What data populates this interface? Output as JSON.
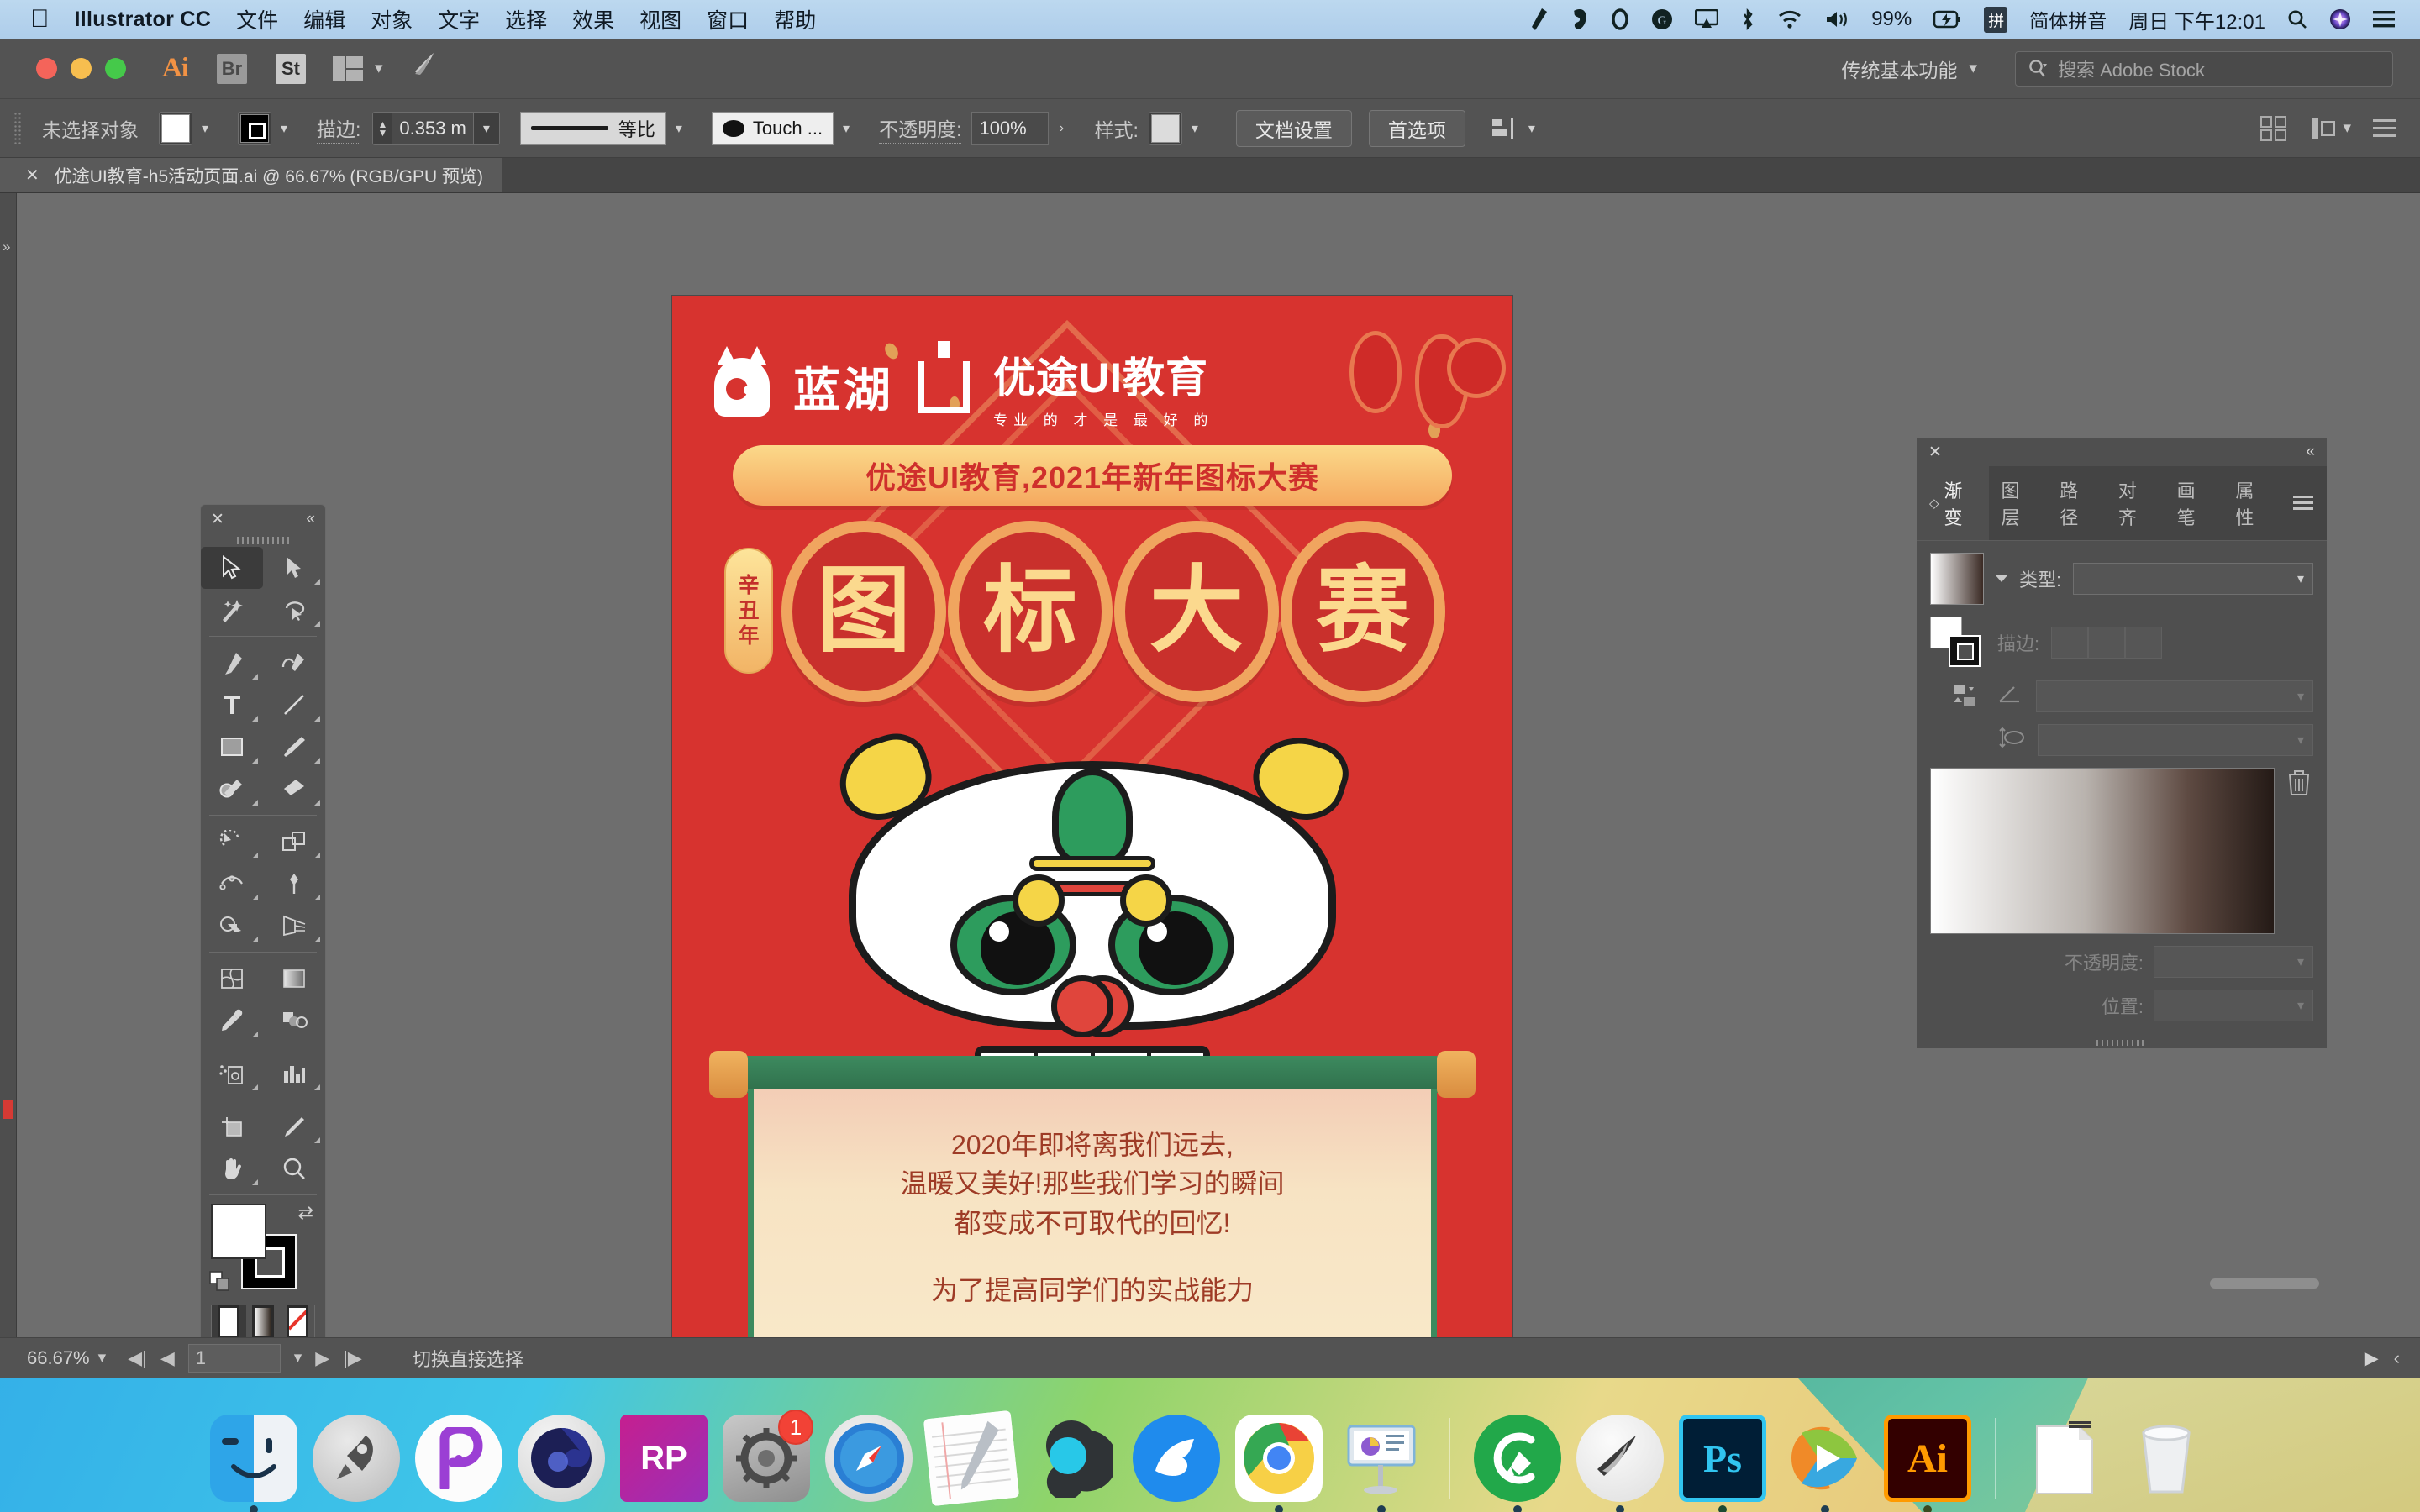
{
  "menubar": {
    "apple": "",
    "app_name": "Illustrator CC",
    "items": [
      "文件",
      "编辑",
      "对象",
      "文字",
      "选择",
      "效果",
      "视图",
      "窗口",
      "帮助"
    ],
    "status": {
      "battery_percent": "99%",
      "ime_chip": "拼",
      "ime_name": "简体拼音",
      "clock": "周日 下午12:01"
    },
    "icons": [
      "pen-tool-icon",
      "evernote-icon",
      "circle-icon",
      "grammarly-icon",
      "airplay-icon",
      "bluetooth-icon",
      "wifi-icon",
      "volume-icon",
      "battery-icon",
      "search-icon",
      "siri-icon",
      "control-center-icon"
    ]
  },
  "appbar": {
    "ai_logo": "Ai",
    "bridge_label": "Br",
    "stock_label": "St",
    "workspace": "传统基本功能",
    "search_placeholder": "搜索 Adobe Stock"
  },
  "controlbar": {
    "selection_status": "未选择对象",
    "stroke_label": "描边:",
    "stroke_width": "0.353 m",
    "stroke_profile": "等比",
    "brush": "Touch ...",
    "opacity_label": "不透明度:",
    "opacity_value": "100%",
    "style_label": "样式:",
    "doc_setup_button": "文档设置",
    "preferences_button": "首选项"
  },
  "document_tab": {
    "title": "优途UI教育-h5活动页面.ai @ 66.67% (RGB/GPU 预览)",
    "close": "✕"
  },
  "tools": {
    "title_close": "✕",
    "collapse": "«",
    "items": [
      {
        "name": "selection-tool",
        "active": true
      },
      {
        "name": "direct-selection-tool",
        "active": false
      },
      {
        "name": "magic-wand-tool",
        "active": false
      },
      {
        "name": "lasso-tool",
        "active": false
      },
      {
        "name": "pen-tool",
        "active": false
      },
      {
        "name": "curvature-tool",
        "active": false
      },
      {
        "name": "type-tool",
        "active": false
      },
      {
        "name": "line-segment-tool",
        "active": false
      },
      {
        "name": "rectangle-tool",
        "active": false
      },
      {
        "name": "paintbrush-tool",
        "active": false
      },
      {
        "name": "shaper-tool",
        "active": false
      },
      {
        "name": "eraser-tool",
        "active": false
      },
      {
        "name": "rotate-tool",
        "active": false
      },
      {
        "name": "scale-tool",
        "active": false
      },
      {
        "name": "width-tool",
        "active": false
      },
      {
        "name": "free-transform-tool",
        "active": false
      },
      {
        "name": "shape-builder-tool",
        "active": false
      },
      {
        "name": "perspective-grid-tool",
        "active": false
      },
      {
        "name": "mesh-tool",
        "active": false
      },
      {
        "name": "gradient-tool",
        "active": false
      },
      {
        "name": "eyedropper-tool",
        "active": false
      },
      {
        "name": "blend-tool",
        "active": false
      },
      {
        "name": "symbol-sprayer-tool",
        "active": false
      },
      {
        "name": "column-graph-tool",
        "active": false
      },
      {
        "name": "artboard-tool",
        "active": false
      },
      {
        "name": "slice-tool",
        "active": false
      },
      {
        "name": "hand-tool",
        "active": false
      },
      {
        "name": "zoom-tool",
        "active": false
      }
    ],
    "fill_color": "#ffffff",
    "stroke_color": "#000000"
  },
  "gradient_panel": {
    "close": "✕",
    "collapse": "«",
    "tabs": [
      {
        "label": "渐变",
        "active": true
      },
      {
        "label": "图层",
        "active": false
      },
      {
        "label": "路径",
        "active": false
      },
      {
        "label": "对齐",
        "active": false
      },
      {
        "label": "画笔",
        "active": false
      },
      {
        "label": "属性",
        "active": false
      }
    ],
    "type_label": "类型:",
    "type_value": "",
    "stroke_label": "描边:",
    "angle_value": "",
    "aspect_value": "",
    "opacity_label": "不透明度:",
    "opacity_value": "",
    "position_label": "位置:",
    "position_value": "",
    "gradient_start": "#ffffff",
    "gradient_end": "#241a16"
  },
  "statusbar": {
    "zoom": "66.67%",
    "page": "1",
    "tool_status": "切换直接选择"
  },
  "artwork": {
    "background_color": "#d7332f",
    "logo_primary": "蓝湖",
    "logo_secondary": "优途UI教育",
    "logo_tagline": "专业 的 才 是 最 好 的",
    "banner_text": "优途UI教育,2021年新年图标大赛",
    "year_tag": [
      "辛",
      "丑",
      "年"
    ],
    "medallions": [
      "图",
      "标",
      "大",
      "赛"
    ],
    "scroll_lines": [
      "2020年即将离我们远去,",
      "温暖又美好!那些我们学习的瞬间",
      "都变成不可取代的回忆!"
    ],
    "scroll_line2": "为了提高同学们的实战能力"
  },
  "dock": {
    "items": [
      {
        "name": "finder",
        "running": true
      },
      {
        "name": "launchpad",
        "running": false
      },
      {
        "name": "pixso",
        "running": false
      },
      {
        "name": "cinema4d",
        "running": false
      },
      {
        "name": "axure-rp",
        "running": false
      },
      {
        "name": "system-preferences",
        "running": false,
        "badge": "1"
      },
      {
        "name": "safari",
        "running": false
      },
      {
        "name": "notes",
        "running": false
      },
      {
        "name": "qq",
        "running": false
      },
      {
        "name": "eagle",
        "running": false
      },
      {
        "name": "chrome",
        "running": true
      },
      {
        "name": "keynote",
        "running": true
      },
      {
        "name": "cleanmymac",
        "running": true
      },
      {
        "name": "sketch-pen",
        "running": true
      },
      {
        "name": "photoshop",
        "running": true
      },
      {
        "name": "tencent-video",
        "running": true
      },
      {
        "name": "illustrator",
        "running": true
      },
      {
        "name": "documents-stack",
        "running": false
      },
      {
        "name": "trash",
        "running": false
      }
    ]
  }
}
